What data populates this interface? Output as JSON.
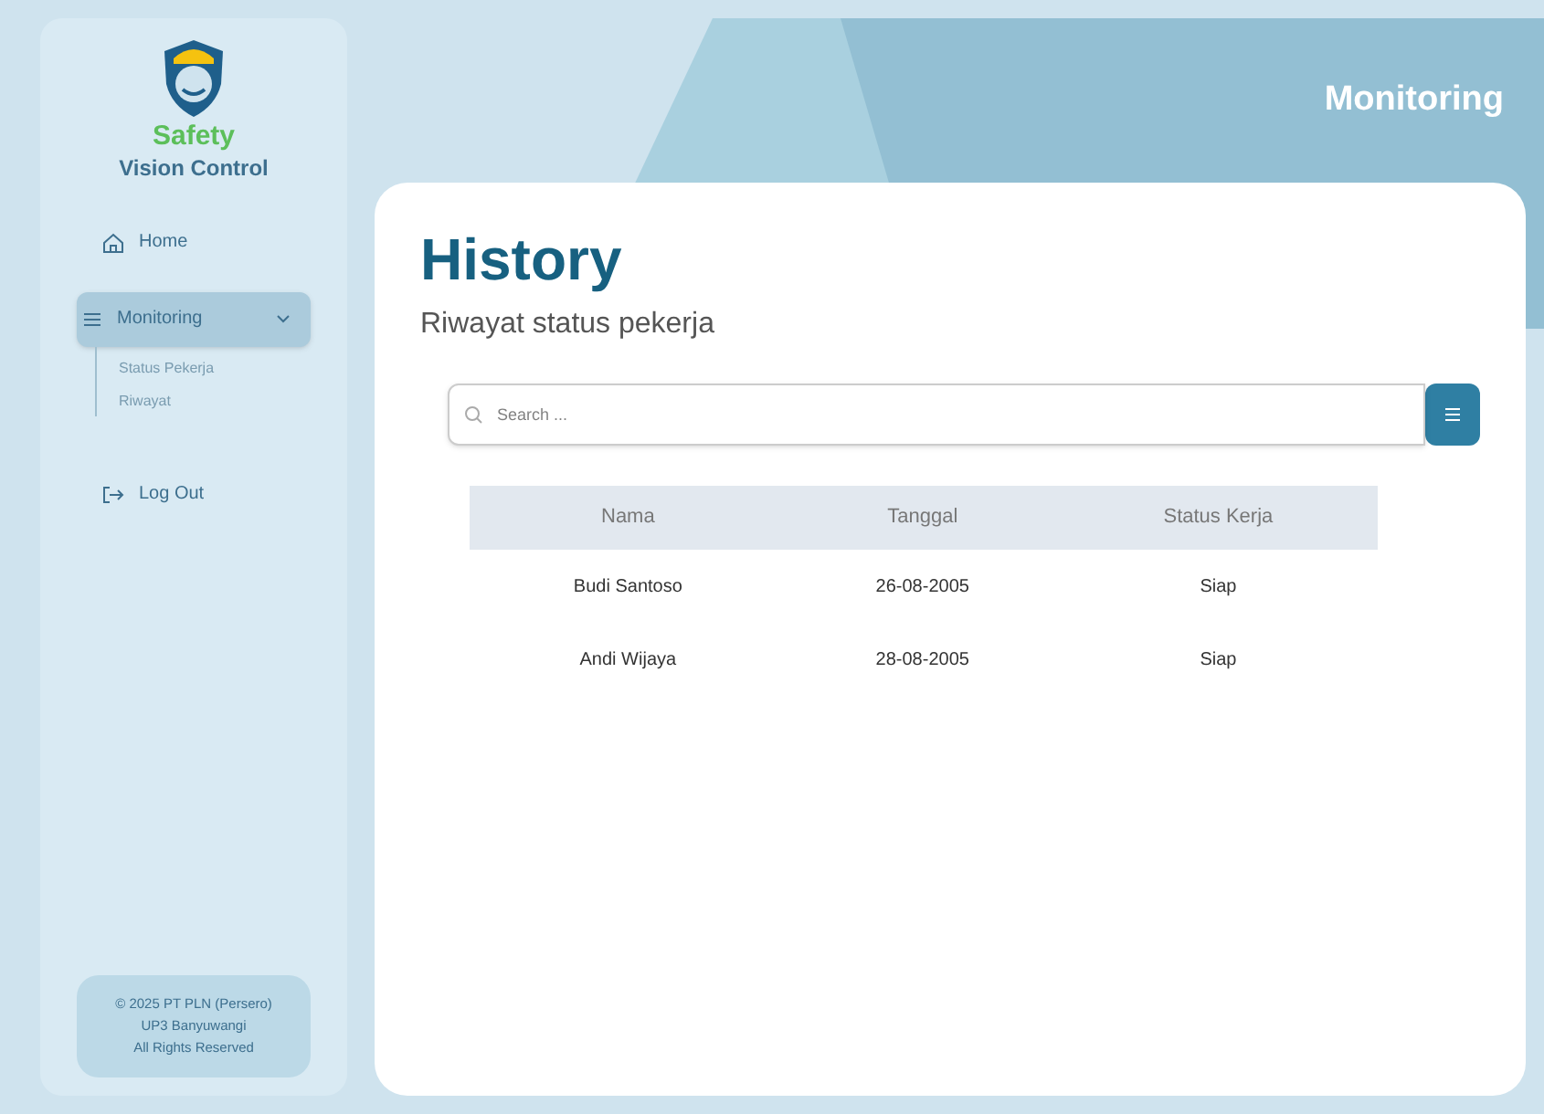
{
  "brand": {
    "line_1": "Safety",
    "line_2": "Vision Control"
  },
  "nav": [
    {
      "kind": "home",
      "label": "Home",
      "selected": false
    },
    {
      "kind": "group",
      "label": "Monitoring",
      "selected": true,
      "expanded": true,
      "children": [
        {
          "label": "Status Pekerja",
          "selected": false
        },
        {
          "label": "Riwayat",
          "selected": false
        }
      ]
    },
    {
      "kind": "logout",
      "label": "Log Out",
      "selected": false
    }
  ],
  "footer": [
    "© 2025 PT PLN (Persero)",
    "UP3 Banyuwangi",
    "All Rights Reserved"
  ],
  "header": {
    "title": "Monitoring"
  },
  "page": {
    "title": "History",
    "subtitle": "Riwayat status pekerja"
  },
  "search": {
    "placeholder": "Search ..."
  },
  "table": {
    "columns": [
      "Nama",
      "Tanggal",
      "Status Kerja"
    ],
    "rows": [
      [
        "Budi Santoso",
        "26-08-2005",
        "Siap"
      ],
      [
        "Andi Wijaya",
        "28-08-2005",
        "Siap"
      ]
    ]
  }
}
